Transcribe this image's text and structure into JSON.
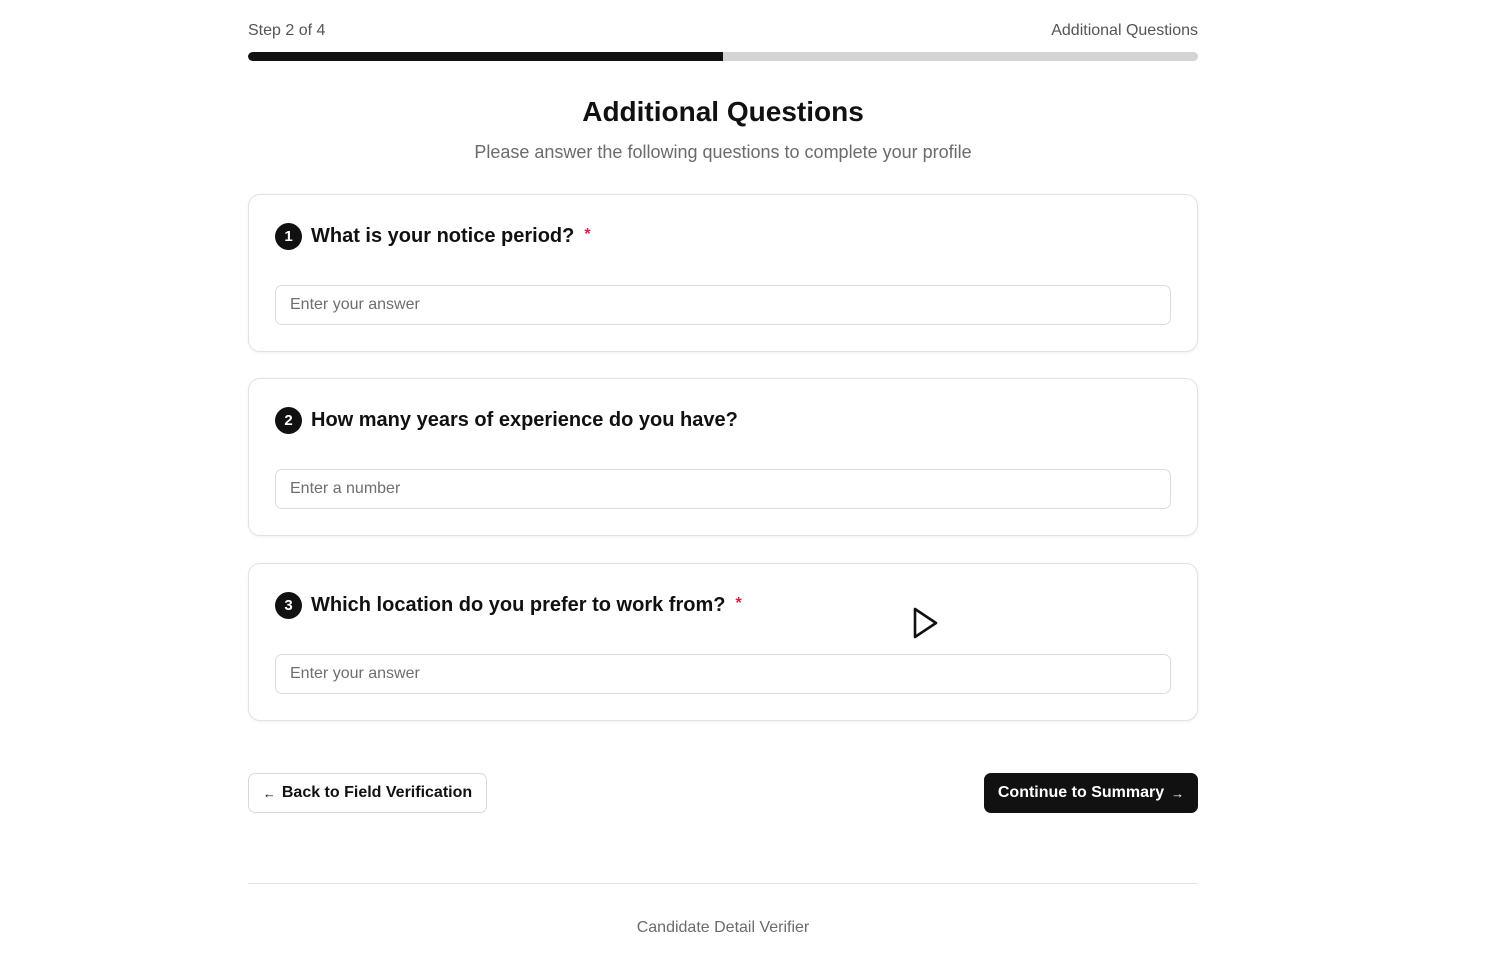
{
  "progress": {
    "step_label": "Step 2 of 4",
    "section_label": "Additional Questions",
    "fraction_complete": 0.5
  },
  "header": {
    "title": "Additional Questions",
    "subtitle": "Please answer the following questions to complete your profile"
  },
  "questions": [
    {
      "number": "1",
      "text": "What is your notice period?",
      "required_mark": "*",
      "placeholder": "Enter your answer",
      "value": ""
    },
    {
      "number": "2",
      "text": "How many years of experience do you have?",
      "required_mark": "",
      "placeholder": "Enter a number",
      "value": ""
    },
    {
      "number": "3",
      "text": "Which location do you prefer to work from?",
      "required_mark": "*",
      "placeholder": "Enter your answer",
      "value": ""
    }
  ],
  "actions": {
    "back_arrow": "←",
    "back_label": "Back to Field Verification",
    "continue_label": "Continue to Summary",
    "continue_arrow": "→"
  },
  "footer": {
    "text": "Candidate Detail Verifier"
  },
  "colors": {
    "accent": "#111111",
    "required": "#e11d48",
    "track": "#d4d4d4"
  }
}
